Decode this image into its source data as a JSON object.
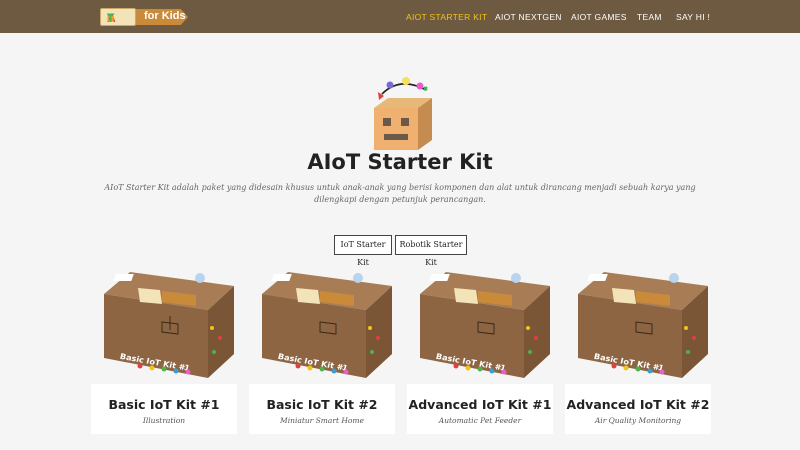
{
  "navbar": {
    "logo": {
      "left_text": "AIoT",
      "right_text": "for Kids"
    },
    "items": [
      {
        "label": "AIOT STARTER KIT",
        "active": true
      },
      {
        "label": "AIOT NEXTGEN",
        "active": false
      },
      {
        "label": "AIOT GAMES",
        "active": false
      },
      {
        "label": "TEAM",
        "active": false
      },
      {
        "label": "SAY HI !",
        "active": false
      }
    ]
  },
  "hero": {
    "title": "AIoT Starter Kit",
    "description": "AIoT Starter Kit adalah paket yang didesain khusus untuk anak-anak yang berisi komponen dan alat untuk dirancang menjadi sebuah karya yang dilengkapi dengan petunjuk perancangan."
  },
  "tabs": [
    {
      "label": "IoT Starter Kit"
    },
    {
      "label": "Robotik Starter Kit"
    }
  ],
  "products": [
    {
      "box_label": "Basic IoT Kit #1",
      "title": "Basic IoT Kit #1",
      "subtitle": "Illustration"
    },
    {
      "box_label": "Basic IoT Kit #1",
      "title": "Basic IoT Kit #2",
      "subtitle": "Miniatur Smart Home"
    },
    {
      "box_label": "Basic IoT Kit #1",
      "title": "Advanced IoT Kit #1",
      "subtitle": "Automatic Pet Feeder"
    },
    {
      "box_label": "Basic IoT Kit #1",
      "title": "Advanced IoT Kit #2",
      "subtitle": "Air Quality Monitoring"
    }
  ],
  "colors": {
    "navbar_bg": "#6e5a40",
    "nav_active": "#f0c419",
    "page_bg": "#f5f5f5",
    "box_brown": "#a87d56"
  }
}
